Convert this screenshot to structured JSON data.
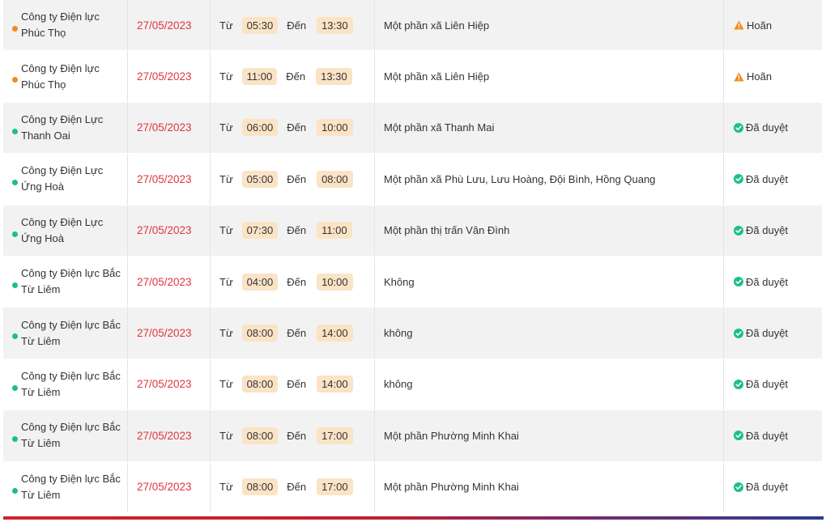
{
  "labels": {
    "from": "Từ",
    "to": "Đến"
  },
  "colors": {
    "pending": "#f28b1c",
    "approved": "#1cbf8a",
    "date": "#e0353d",
    "time_pill": "#fbe3c6"
  },
  "rows": [
    {
      "company": [
        "Công ty Điện lực",
        "Phúc Thọ"
      ],
      "date": "27/05/2023",
      "from": "05:30",
      "to": "13:30",
      "area": "Một phần xã Liên Hiệp",
      "status": "Hoãn",
      "status_type": "pending",
      "status_icon": "warning-icon"
    },
    {
      "company": [
        "Công ty Điện lực",
        "Phúc Thọ"
      ],
      "date": "27/05/2023",
      "from": "11:00",
      "to": "13:30",
      "area": "Một phần xã Liên Hiệp",
      "status": "Hoãn",
      "status_type": "pending",
      "status_icon": "warning-icon"
    },
    {
      "company": [
        "Công ty Điện Lực",
        "Thanh Oai"
      ],
      "date": "27/05/2023",
      "from": "06:00",
      "to": "10:00",
      "area": "Một phần xã Thanh Mai",
      "status": "Đã duyệt",
      "status_type": "approved",
      "status_icon": "check-circle-icon"
    },
    {
      "company": [
        "Công ty Điện Lực",
        "Ứng Hoà"
      ],
      "date": "27/05/2023",
      "from": "05:00",
      "to": "08:00",
      "area": "Một phần xã Phù Lưu, Lưu Hoàng, Đội Bình, Hồng Quang",
      "status": "Đã duyệt",
      "status_type": "approved",
      "status_icon": "check-circle-icon"
    },
    {
      "company": [
        "Công ty Điện Lực",
        "Ứng Hoà"
      ],
      "date": "27/05/2023",
      "from": "07:30",
      "to": "11:00",
      "area": "Một phần thị trấn Vân Đình",
      "status": "Đã duyệt",
      "status_type": "approved",
      "status_icon": "check-circle-icon"
    },
    {
      "company": [
        "Công ty Điện lực Bắc",
        "Từ Liêm"
      ],
      "date": "27/05/2023",
      "from": "04:00",
      "to": "10:00",
      "area": "Không",
      "status": "Đã duyệt",
      "status_type": "approved",
      "status_icon": "check-circle-icon"
    },
    {
      "company": [
        "Công ty Điện lực Bắc",
        "Từ Liêm"
      ],
      "date": "27/05/2023",
      "from": "08:00",
      "to": "14:00",
      "area": "không",
      "status": "Đã duyệt",
      "status_type": "approved",
      "status_icon": "check-circle-icon"
    },
    {
      "company": [
        "Công ty Điện lực Bắc",
        "Từ Liêm"
      ],
      "date": "27/05/2023",
      "from": "08:00",
      "to": "14:00",
      "area": "không",
      "status": "Đã duyệt",
      "status_type": "approved",
      "status_icon": "check-circle-icon"
    },
    {
      "company": [
        "Công ty Điện lực Bắc",
        "Từ Liêm"
      ],
      "date": "27/05/2023",
      "from": "08:00",
      "to": "17:00",
      "area": "Một phần Phường Minh Khai",
      "status": "Đã duyệt",
      "status_type": "approved",
      "status_icon": "check-circle-icon"
    },
    {
      "company": [
        "Công ty Điện lực Bắc",
        "Từ Liêm"
      ],
      "date": "27/05/2023",
      "from": "08:00",
      "to": "17:00",
      "area": "Một phần Phường Minh Khai",
      "status": "Đã duyệt",
      "status_type": "approved",
      "status_icon": "check-circle-icon"
    }
  ]
}
